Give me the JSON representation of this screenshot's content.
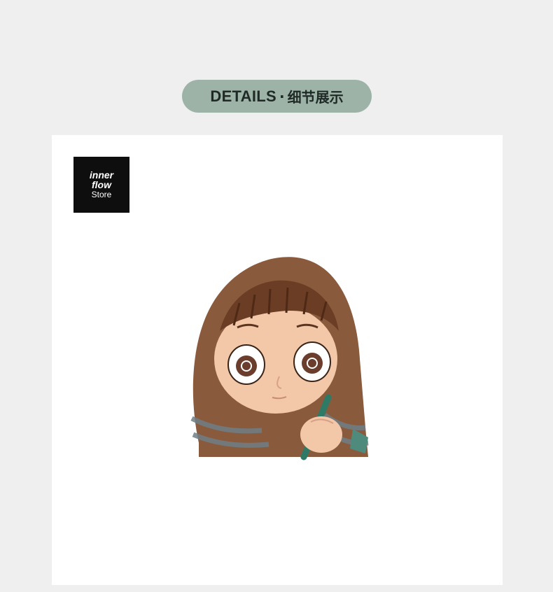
{
  "header": {
    "title_en": "DETAILS",
    "separator": "·",
    "title_zh": "细节展示",
    "pill_color": "#9db3a8"
  },
  "logo": {
    "line1": "inner",
    "line2": "flow",
    "line3": "Store"
  },
  "product_image": {
    "icon": "figurine-illustration"
  }
}
